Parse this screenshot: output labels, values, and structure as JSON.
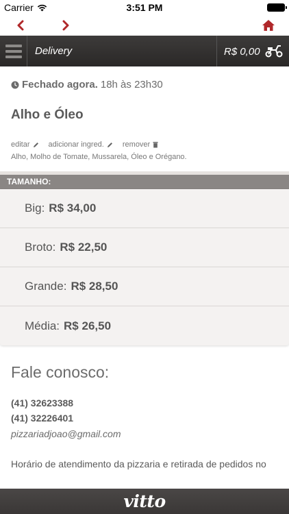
{
  "status_bar": {
    "carrier": "Carrier",
    "time": "3:51 PM"
  },
  "nav": {
    "back_icon": "chevron-left-icon",
    "forward_icon": "chevron-right-icon",
    "home_icon": "home-icon",
    "accent_color": "#b0282a"
  },
  "header": {
    "title": "Delivery",
    "cart_total": "R$ 0,00",
    "cart_icon": "scooter-icon"
  },
  "store": {
    "status": "Fechado agora.",
    "hours": "18h às 23h30"
  },
  "product": {
    "name": "Alho e Óleo",
    "actions": [
      {
        "label": "editar",
        "icon": "pencil-icon"
      },
      {
        "label": "adicionar ingred.",
        "icon": "pencil-icon"
      },
      {
        "label": "remover",
        "icon": "trash-icon"
      }
    ],
    "ingredients": "Alho, Molho de Tomate, Mussarela, Óleo e Orégano."
  },
  "sizes": {
    "header": "TAMANHO:",
    "items": [
      {
        "label": "Big:",
        "price": "R$ 34,00"
      },
      {
        "label": "Broto:",
        "price": "R$ 22,50"
      },
      {
        "label": "Grande:",
        "price": "R$ 28,50"
      },
      {
        "label": "Média:",
        "price": "R$ 26,50"
      }
    ]
  },
  "contact": {
    "title": "Fale conosco:",
    "phones": [
      "(41) 32623388",
      "(41) 32226401"
    ],
    "email": "pizzariadjoao@gmail.com",
    "hours_text": "Horário de atendimento da pizzaria e retirada de pedidos no"
  },
  "footer": {
    "logo": "vitto"
  }
}
